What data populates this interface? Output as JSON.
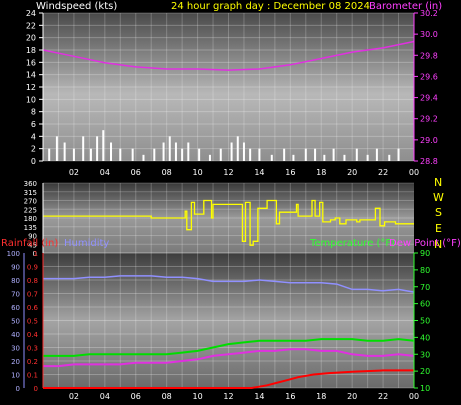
{
  "header": {
    "wind_label": "Windspeed (kts)",
    "date_label": "24 hour graph day : December 08 2024",
    "baro_label": "Barometer (in)"
  },
  "compass": [
    "N",
    "W",
    "S",
    "E",
    "N"
  ],
  "bottom_header": {
    "rain_label": "Rainfall (in)",
    "humidity_label": "Humidity",
    "temp_label": "Temperature (°F)",
    "dew_label": "Dew Point (°F)"
  },
  "colors": {
    "wind": "#ffffff",
    "barometer": "#e030e0",
    "direction": "#ffff00",
    "humidity": "#9090ff",
    "temperature": "#00dd00",
    "dewpoint": "#e030e0",
    "rainfall": "#ff0000",
    "rain_axis": "#ff3030",
    "temp_axis": "#30ff30",
    "baro_axis": "#ff40ff"
  },
  "x_ticks": [
    "02",
    "04",
    "06",
    "08",
    "10",
    "12",
    "14",
    "16",
    "18",
    "20",
    "22",
    "00"
  ],
  "chart_data": [
    {
      "type": "line",
      "x_range_hours": [
        0,
        24
      ],
      "series": [
        {
          "name": "Windspeed (kts)",
          "axis": "left",
          "ylim": [
            0,
            24
          ],
          "yticks": [
            0,
            2,
            4,
            6,
            8,
            10,
            12,
            14,
            16,
            18,
            20,
            22,
            24
          ],
          "style": "bars",
          "x": [
            0.4,
            0.9,
            1.4,
            2.0,
            2.6,
            3.1,
            3.5,
            3.9,
            4.4,
            5.0,
            5.8,
            6.5,
            7.2,
            7.8,
            8.2,
            8.6,
            9.0,
            9.4,
            10.1,
            10.8,
            11.5,
            12.2,
            12.6,
            13.0,
            13.4,
            14.0,
            14.8,
            15.6,
            16.2,
            17.0,
            17.6,
            18.2,
            18.8,
            19.5,
            20.3,
            21.0,
            21.6,
            22.4,
            23.0
          ],
          "values": [
            2,
            4,
            3,
            2,
            4,
            2,
            4,
            5,
            3,
            2,
            2,
            1,
            2,
            3,
            4,
            3,
            2,
            3,
            2,
            1,
            2,
            3,
            4,
            3,
            2,
            2,
            1,
            2,
            1,
            2,
            2,
            1,
            2,
            1,
            2,
            1,
            2,
            1,
            2
          ]
        },
        {
          "name": "Barometer (in)",
          "axis": "right",
          "ylim": [
            28.8,
            30.2
          ],
          "yticks": [
            28.8,
            29.0,
            29.2,
            29.4,
            29.6,
            29.8,
            30.0,
            30.2
          ],
          "x": [
            0,
            2,
            4,
            6,
            8,
            10,
            12,
            14,
            16,
            18,
            20,
            22,
            24
          ],
          "values": [
            29.85,
            29.79,
            29.73,
            29.69,
            29.67,
            29.67,
            29.66,
            29.67,
            29.71,
            29.77,
            29.83,
            29.87,
            29.93
          ]
        }
      ]
    },
    {
      "type": "line",
      "x_range_hours": [
        0,
        24
      ],
      "series": [
        {
          "name": "Wind Direction",
          "ylim": [
            0,
            360
          ],
          "yticks": [
            0,
            45,
            90,
            135,
            180,
            225,
            270,
            315,
            360
          ],
          "x": [
            0,
            6.9,
            7.0,
            9.2,
            9.3,
            9.6,
            9.8,
            10.4,
            10.9,
            11.0,
            12.8,
            12.9,
            13.1,
            13.4,
            13.6,
            13.9,
            14.5,
            15.1,
            15.3,
            16.4,
            16.5,
            17.4,
            17.6,
            17.9,
            18.1,
            18.6,
            18.9,
            19.2,
            19.6,
            20.3,
            20.5,
            21.2,
            21.5,
            21.8,
            22.1,
            22.8,
            24
          ],
          "values": [
            190,
            190,
            180,
            215,
            120,
            260,
            200,
            270,
            180,
            250,
            250,
            60,
            260,
            40,
            60,
            230,
            270,
            150,
            210,
            250,
            190,
            270,
            190,
            260,
            160,
            170,
            180,
            150,
            170,
            160,
            170,
            170,
            230,
            140,
            160,
            150,
            150
          ]
        }
      ]
    },
    {
      "type": "line",
      "x_range_hours": [
        0,
        24
      ],
      "series": [
        {
          "name": "Humidity",
          "axis": "left-humidity",
          "ylim": [
            0,
            100
          ],
          "yticks": [
            0,
            10,
            20,
            30,
            40,
            50,
            60,
            70,
            80,
            90,
            100
          ],
          "x": [
            0,
            1,
            2,
            3,
            4,
            5,
            6,
            7,
            8,
            9,
            10,
            11,
            12,
            13,
            14,
            15,
            16,
            17,
            18,
            19,
            20,
            21,
            22,
            23,
            24
          ],
          "values": [
            81,
            81,
            81,
            82,
            82,
            83,
            83,
            83,
            82,
            82,
            81,
            79,
            79,
            79,
            80,
            79,
            78,
            78,
            78,
            77,
            73,
            73,
            72,
            73,
            71
          ]
        },
        {
          "name": "Rainfall (in)",
          "axis": "left-rain",
          "ylim": [
            0,
            1
          ],
          "yticks": [
            0,
            0.1,
            0.2,
            0.3,
            0.4,
            0.5,
            0.6,
            0.7,
            0.8,
            0.9,
            1
          ],
          "x": [
            0,
            13.5,
            14.5,
            15.5,
            16.5,
            17.5,
            18.5,
            20,
            22,
            23.5,
            24
          ],
          "values": [
            0,
            0,
            0.02,
            0.05,
            0.08,
            0.1,
            0.11,
            0.12,
            0.13,
            0.13,
            0.13
          ]
        },
        {
          "name": "Temperature (°F)",
          "axis": "right",
          "ylim": [
            10,
            90
          ],
          "yticks": [
            10,
            20,
            30,
            40,
            50,
            60,
            70,
            80,
            90
          ],
          "x": [
            0,
            1,
            2,
            3,
            4,
            5,
            6,
            7,
            8,
            9,
            10,
            11,
            12,
            13,
            14,
            15,
            16,
            17,
            18,
            19,
            20,
            21,
            22,
            23,
            24
          ],
          "values": [
            29,
            29,
            29,
            30,
            30,
            30,
            30,
            30,
            30,
            31,
            32,
            34,
            36,
            37,
            38,
            38,
            38,
            38,
            39,
            39,
            39,
            38,
            38,
            39,
            38
          ]
        },
        {
          "name": "Dew Point (°F)",
          "axis": "right",
          "ylim": [
            10,
            90
          ],
          "x": [
            0,
            1,
            2,
            3,
            4,
            5,
            6,
            7,
            8,
            9,
            10,
            11,
            12,
            13,
            14,
            15,
            16,
            17,
            18,
            19,
            20,
            21,
            22,
            23,
            24
          ],
          "values": [
            23,
            23,
            24,
            24,
            24,
            24,
            25,
            25,
            25,
            26,
            27,
            29,
            30,
            31,
            32,
            32,
            33,
            33,
            32,
            32,
            30,
            29,
            29,
            30,
            29
          ]
        }
      ]
    }
  ]
}
